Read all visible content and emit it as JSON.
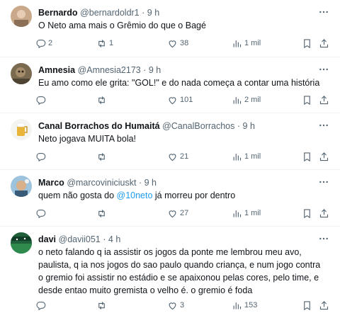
{
  "tweets": [
    {
      "name": "Bernardo",
      "handle": "@bernardoldr1",
      "dot": "·",
      "time": "9 h",
      "text": "O Neto ama mais o Grêmio do que o Bagé",
      "replies": "2",
      "retweets": "1",
      "likes": "38",
      "views": "1 mil"
    },
    {
      "name": "Amnesia",
      "handle": "@Amnesia2173",
      "dot": "·",
      "time": "9 h",
      "text": "Eu amo como ele grita: \"GOL!\" e do nada começa a contar uma história",
      "replies": "",
      "retweets": "",
      "likes": "101",
      "views": "2 mil"
    },
    {
      "name": "Canal Borrachos do Humaitá",
      "handle": "@CanalBorrachos",
      "dot": "·",
      "time": "9 h",
      "text": "Neto jogava MUITA bola!",
      "replies": "",
      "retweets": "",
      "likes": "21",
      "views": "1 mil"
    },
    {
      "name": "Marco",
      "handle": "@marcoviniciuskt",
      "dot": "·",
      "time": "9 h",
      "text_before": "quem não gosta do ",
      "mention": "@10neto",
      "text_after": " já morreu por dentro",
      "replies": "",
      "retweets": "",
      "likes": "27",
      "views": "1 mil"
    },
    {
      "name": "davi",
      "handle": "@davii051",
      "dot": "·",
      "time": "4 h",
      "text": "o neto falando q ia assistir os jogos da ponte me lembrou meu avo, paulista, q ia nos jogos do sao paulo quando criança, e num jogo contra o gremio foi assistir no estádio e se apaixonou pelas cores, pelo time, e desde entao muito gremista o velho é. o gremio é foda",
      "replies": "",
      "retweets": "",
      "likes": "3",
      "views": "153"
    }
  ],
  "icons": {
    "more": "more-horizontal-icon",
    "reply": "reply-icon",
    "retweet": "retweet-icon",
    "like": "heart-icon",
    "views": "views-bar-chart-icon",
    "bookmark": "bookmark-icon",
    "share": "share-icon"
  },
  "colors": {
    "text": "#0f1419",
    "secondary": "#536471",
    "link": "#1d9bf0",
    "divider": "#eff3f4"
  }
}
